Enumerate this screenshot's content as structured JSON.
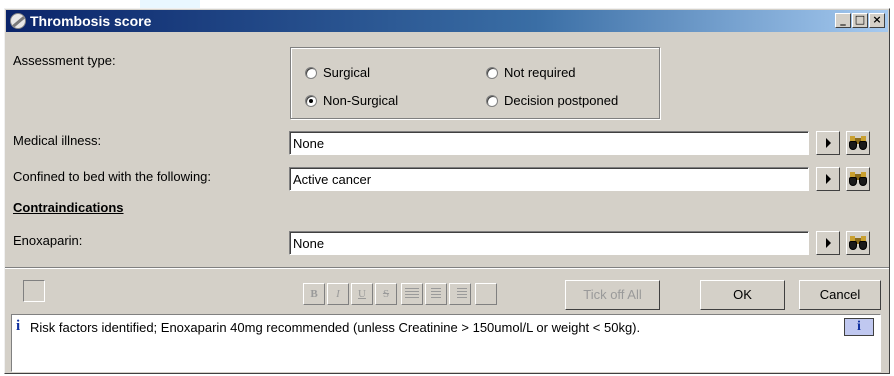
{
  "window": {
    "title": "Thrombosis score",
    "minimize_label": "_",
    "maximize_label": "□",
    "close_label": "×"
  },
  "assessment": {
    "label": "Assessment type:",
    "options": [
      {
        "label": "Surgical",
        "checked": false
      },
      {
        "label": "Non-Surgical",
        "checked": true
      },
      {
        "label": "Not required",
        "checked": false
      },
      {
        "label": "Decision postponed",
        "checked": false
      }
    ]
  },
  "medical_illness": {
    "label": "Medical illness:",
    "value": "None"
  },
  "confined_to_bed": {
    "label": "Confined to bed with the following:",
    "value": "Active cancer"
  },
  "contraindications": {
    "heading": "Contraindications"
  },
  "enoxaparin": {
    "label": "Enoxaparin:",
    "value": "None"
  },
  "toolbar": {
    "bold": "B",
    "italic": "I",
    "underline": "U",
    "strike": "S",
    "tick_off_all": "Tick off All",
    "ok": "OK",
    "cancel": "Cancel"
  },
  "message": {
    "icon_glyph": "i",
    "text": "Risk factors identified; Enoxaparin 40mg recommended (unless Creatinine > 150umol/L or weight < 50kg).",
    "info_glyph": "i"
  },
  "icons": {
    "title": "app-icon",
    "dropdown": "arrow-right-icon",
    "search": "binoculars-icon",
    "info": "info-icon"
  }
}
